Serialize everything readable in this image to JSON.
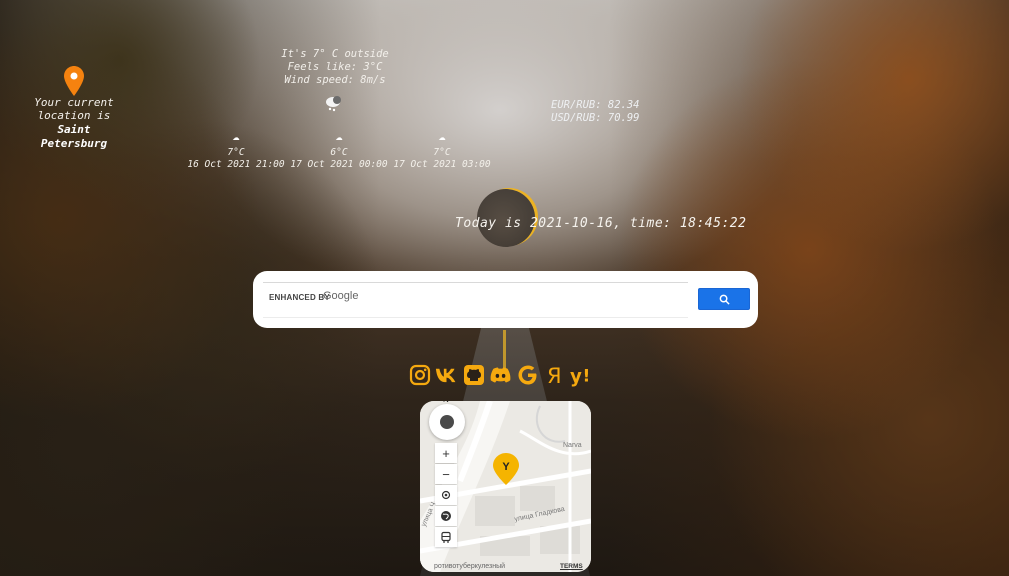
{
  "location": {
    "line1": "Your current",
    "line2": "location is",
    "city1": "Saint",
    "city2": "Petersburg"
  },
  "current_weather": {
    "temp_line": "It's 7° C outside",
    "feels_line": "Feels like: 3°C",
    "wind_line": "Wind speed: 8m/s",
    "icon": "snow-cloud-icon"
  },
  "forecast": [
    {
      "icon": "cloud-icon",
      "temp": "7°C",
      "time": "16 Oct 2021 21:00"
    },
    {
      "icon": "cloud-icon",
      "temp": "6°C",
      "time": "17 Oct 2021 00:00"
    },
    {
      "icon": "snow-cloud-icon",
      "temp": "7°C",
      "time": "17 Oct 2021 03:00"
    }
  ],
  "currency": {
    "eur": "EUR/RUB: 82.34",
    "usd": "USD/RUB: 70.99"
  },
  "clock": {
    "text": "Today is 2021-10-16, time: 18:45:22"
  },
  "search": {
    "label": "ENHANCED BY",
    "brand": "Google",
    "value": "",
    "button_icon": "search-icon"
  },
  "socials": [
    {
      "name": "instagram-icon"
    },
    {
      "name": "vk-icon"
    },
    {
      "name": "github-icon"
    },
    {
      "name": "discord-icon"
    },
    {
      "name": "google-icon"
    },
    {
      "name": "yandex-icon"
    },
    {
      "name": "yandex-q-icon"
    }
  ],
  "map": {
    "compass_n": "N",
    "zoom_in": "+",
    "zoom_out": "−",
    "street1": "Narva",
    "street2": "улица Гладкова",
    "street3": "улица Ч",
    "copyright": "ротивотуберкулезный",
    "terms": "TERMS",
    "pin_letter": "Y"
  },
  "colors": {
    "accent": "#f5a90f",
    "search_button": "#1a73e8"
  }
}
